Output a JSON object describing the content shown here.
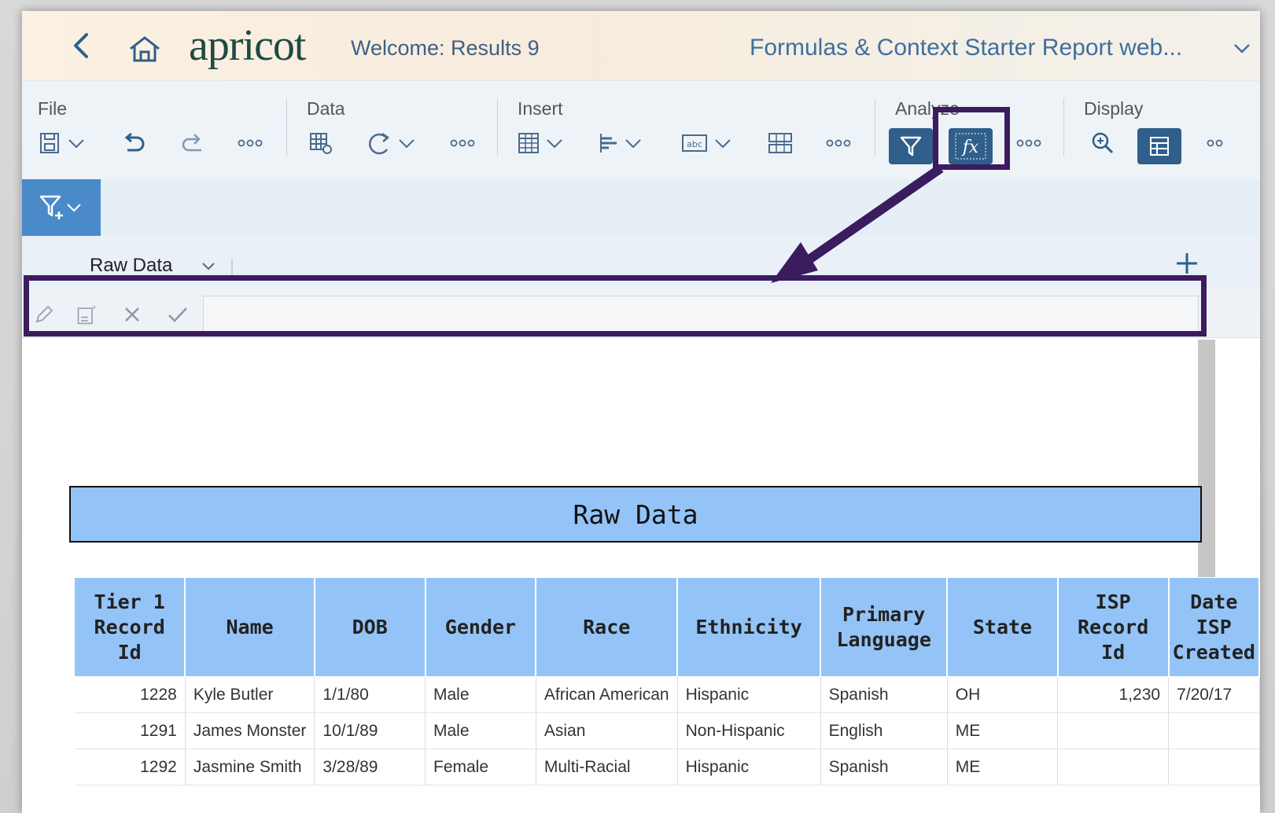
{
  "shell": {
    "logo": "apricot",
    "welcome": "Welcome: Results 9",
    "report_title": "Formulas & Context Starter Report web..."
  },
  "toolbar": {
    "groups": {
      "file": "File",
      "data": "Data",
      "insert": "Insert",
      "analyze": "Analyze",
      "display": "Display"
    }
  },
  "tabs": {
    "active": "Raw Data"
  },
  "formula_bar": {
    "value": ""
  },
  "report": {
    "title": "Raw Data",
    "columns": [
      "Tier 1 Record Id",
      "Name",
      "DOB",
      "Gender",
      "Race",
      "Ethnicity",
      "Primary Language",
      "State",
      "ISP Record Id",
      "Date ISP Created"
    ],
    "rows": [
      [
        "1228",
        "Kyle Butler",
        "1/1/80",
        "Male",
        "African American",
        "Hispanic",
        "Spanish",
        "OH",
        "1,230",
        "7/20/17"
      ],
      [
        "1291",
        "James Monster",
        "10/1/89",
        "Male",
        "Asian",
        "Non-Hispanic",
        "English",
        "ME",
        "",
        ""
      ],
      [
        "1292",
        "Jasmine Smith",
        "3/28/89",
        "Female",
        "Multi-Racial",
        "Hispanic",
        "Spanish",
        "ME",
        "",
        ""
      ]
    ]
  },
  "colors": {
    "header_blue": "#94c4f7",
    "toolbar_active": "#2f5f8a",
    "filter_blue": "#4a8ac9",
    "annotation": "#3b1c5e"
  }
}
